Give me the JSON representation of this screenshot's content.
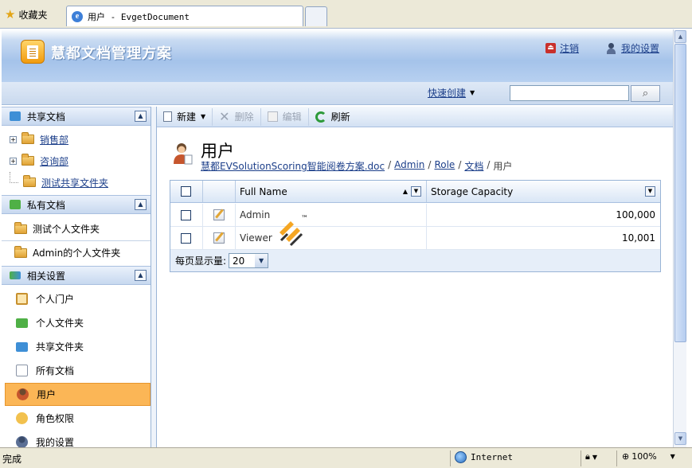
{
  "browser": {
    "favorites_label": "收藏夹",
    "tab_title": "用户 - EvgetDocument"
  },
  "header": {
    "app_title": "慧都文档管理方案",
    "logout_label": "注销",
    "settings_label": "我的设置"
  },
  "quickbar": {
    "quick_create_label": "快速创建",
    "search_value": ""
  },
  "sidebar": {
    "shared_docs": {
      "title": "共享文档",
      "items": [
        {
          "label": "销售部"
        },
        {
          "label": "咨询部"
        },
        {
          "label": "测试共享文件夹"
        }
      ]
    },
    "private_docs": {
      "title": "私有文档",
      "items": [
        {
          "label": "测试个人文件夹"
        },
        {
          "label": "Admin的个人文件夹"
        }
      ]
    },
    "settings": {
      "title": "相关设置",
      "items": [
        {
          "label": "个人门户"
        },
        {
          "label": "个人文件夹"
        },
        {
          "label": "共享文件夹"
        },
        {
          "label": "所有文档"
        },
        {
          "label": "用户"
        },
        {
          "label": "角色权限"
        },
        {
          "label": "我的设置"
        }
      ]
    }
  },
  "toolbar": {
    "new_label": "新建",
    "delete_label": "删除",
    "edit_label": "编辑",
    "refresh_label": "刷新"
  },
  "content": {
    "page_title": "用户",
    "breadcrumb": {
      "b0": "慧都EVSolutionScoring智能阅卷方案.doc",
      "b1": "Admin",
      "b2": "Role",
      "b3": "文档",
      "current": "用户",
      "sep": "/"
    }
  },
  "grid": {
    "columns": {
      "full_name": "Full Name",
      "storage": "Storage Capacity"
    },
    "rows": [
      {
        "full_name": "Admin",
        "storage": "100,000"
      },
      {
        "full_name": "Viewer",
        "storage": "10,001"
      }
    ],
    "pager_label": "每页显示量:",
    "page_size": "20"
  },
  "watermark": {
    "tm": "™"
  },
  "statusbar": {
    "status_text": "完成",
    "zone": "Internet",
    "zoom": "100%"
  },
  "colors": {
    "accent": "#1c3f8a",
    "active_nav": "#fbb656",
    "header_blue": "#a5c3ea"
  }
}
